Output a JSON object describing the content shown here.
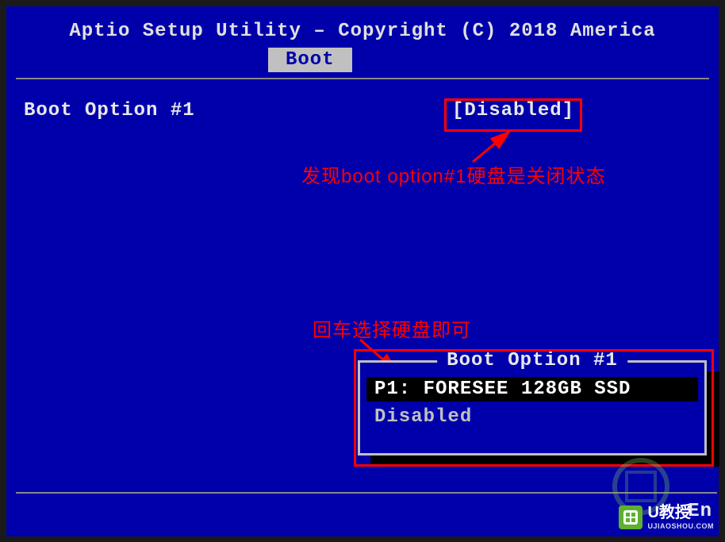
{
  "header": {
    "title": "Aptio Setup Utility – Copyright (C) 2018 America",
    "active_tab": "Boot"
  },
  "setting": {
    "label": "Boot Option #1",
    "value": "[Disabled]"
  },
  "annotations": {
    "note1": "发现boot option#1硬盘是关闭状态",
    "note2": "回车选择硬盘即可"
  },
  "popup": {
    "title": "Boot Option #1",
    "options": [
      {
        "label": "P1: FORESEE 128GB SSD",
        "selected": true
      },
      {
        "label": "Disabled",
        "selected": false
      }
    ]
  },
  "footer": {
    "right_text": "En"
  },
  "watermark": {
    "brand": "U教授",
    "url": "UJIAOSHOU.COM"
  }
}
